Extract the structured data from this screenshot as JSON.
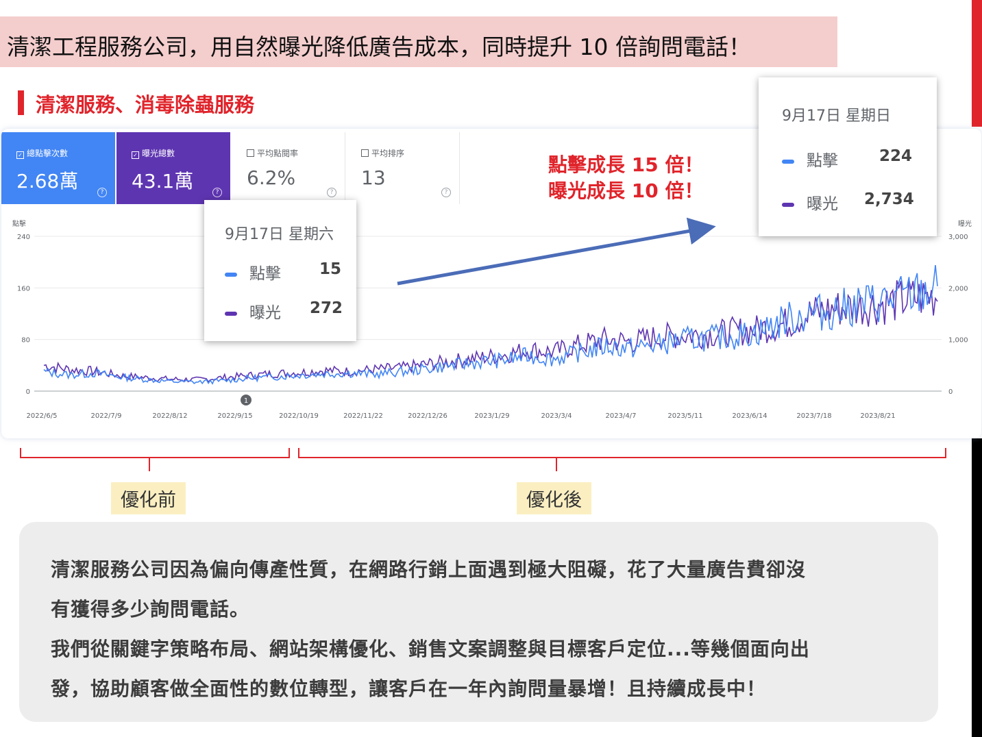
{
  "headline": "清潔工程服務公司，用自然曝光降低廣告成本，同時提升 10 倍詢問電話！",
  "section_title": "清潔服務、消毒除蟲服務",
  "metrics": [
    {
      "label": "總點擊次數",
      "value": "2.68萬",
      "checked": true
    },
    {
      "label": "曝光總數",
      "value": "43.1萬",
      "checked": true
    },
    {
      "label": "平均點閱率",
      "value": "6.2%",
      "checked": false
    },
    {
      "label": "平均排序",
      "value": "13",
      "checked": false
    }
  ],
  "growth": {
    "line1": "點擊成長 15 倍！",
    "line2": "曝光成長 10 倍！"
  },
  "tooltip_before": {
    "date": "9月17日 星期六",
    "clicks_label": "點擊",
    "clicks": "15",
    "impr_label": "曝光",
    "impr": "272"
  },
  "tooltip_after": {
    "date": "9月17日 星期日",
    "clicks_label": "點擊",
    "clicks": "224",
    "impr_label": "曝光",
    "impr": "2,734"
  },
  "labels": {
    "before": "優化前",
    "after": "優化後"
  },
  "description": [
    "清潔服務公司因為偏向傳產性質，在網路行銷上面遇到極大阻礙，花了大量廣告費卻沒",
    "有獲得多少詢問電話。",
    "我們從關鍵字策略布局、網站架構優化、銷售文案調整與目標客戶定位...等幾個面向出",
    "發，協助顧客做全面性的數位轉型，讓客戶在一年內詢問量暴增！且持續成長中！"
  ],
  "chart_data": {
    "type": "line",
    "x_ticks": [
      "2022/6/5",
      "2022/7/9",
      "2022/8/12",
      "2022/9/15",
      "2022/10/19",
      "2022/11/22",
      "2022/12/26",
      "2023/1/29",
      "2023/3/4",
      "2023/4/7",
      "2023/5/11",
      "2023/6/14",
      "2023/7/18",
      "2023/8/21"
    ],
    "y_left_label": "點擊",
    "y_left_ticks": [
      "240",
      "160",
      "80",
      "0"
    ],
    "y_left_range": [
      0,
      240
    ],
    "y_right_label": "曝光",
    "y_right_ticks": [
      "3,000",
      "2,000",
      "1,000",
      "0"
    ],
    "y_right_range": [
      0,
      3000
    ],
    "annotation_marker": "1",
    "series": [
      {
        "name": "點擊",
        "color": "#4285f4",
        "values": [
          30,
          25,
          28,
          22,
          18,
          15,
          14,
          16,
          20,
          22,
          25,
          27,
          28,
          26,
          30,
          35,
          40,
          45,
          48,
          55,
          50,
          60,
          70,
          66,
          72,
          80,
          82,
          85,
          92,
          110,
          120,
          125,
          135,
          140,
          150,
          160
        ]
      },
      {
        "name": "曝光",
        "color": "#5e35b1",
        "values": [
          500,
          420,
          380,
          300,
          260,
          230,
          220,
          260,
          300,
          340,
          360,
          400,
          380,
          420,
          450,
          520,
          580,
          640,
          700,
          800,
          760,
          900,
          1000,
          950,
          1050,
          1080,
          1100,
          1150,
          1200,
          1300,
          1500,
          1600,
          1650,
          1700,
          1800,
          1850
        ]
      }
    ]
  }
}
